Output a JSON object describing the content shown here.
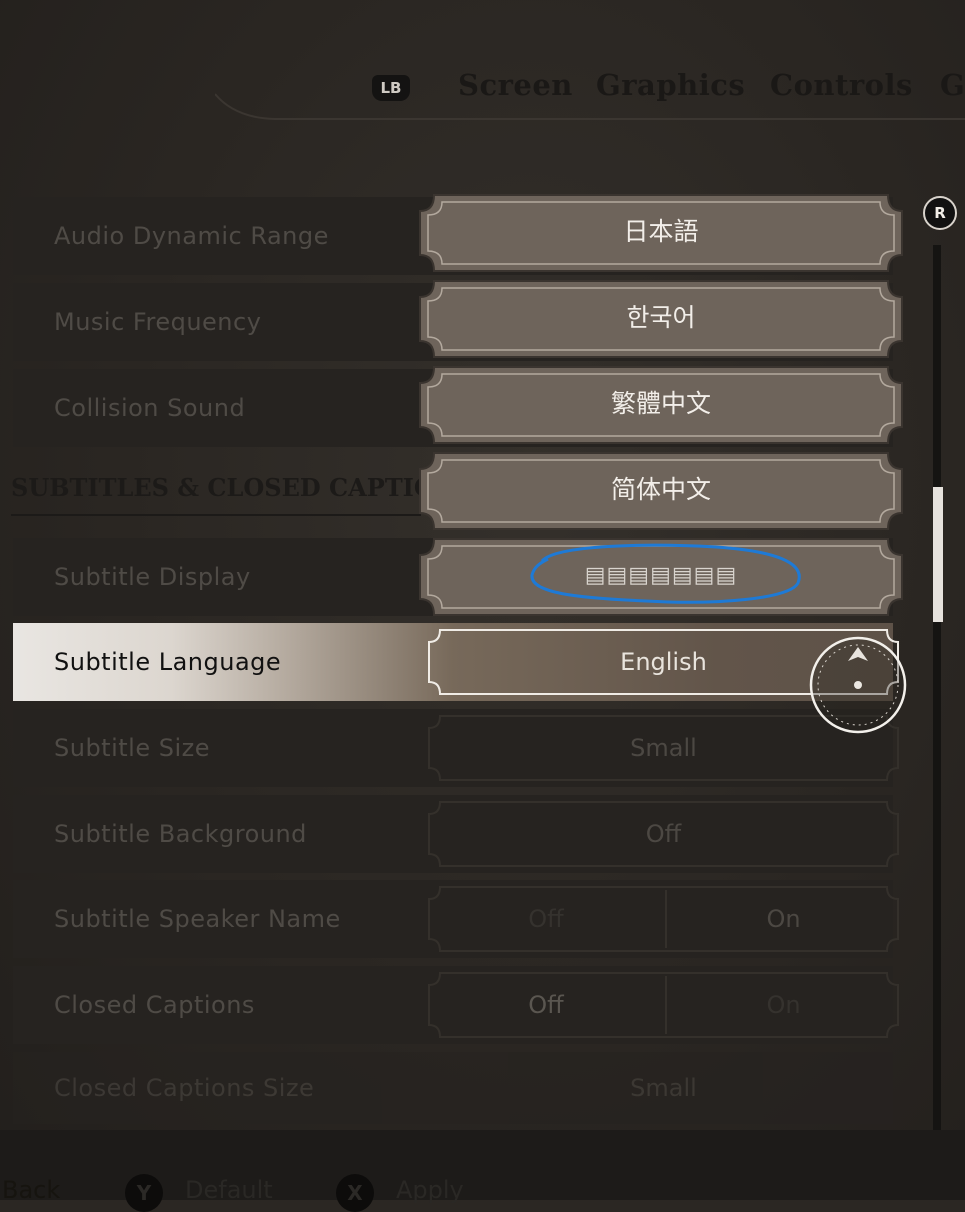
{
  "tabs": {
    "lb_label": "LB",
    "items": [
      {
        "label": "Screen"
      },
      {
        "label": "Graphics"
      },
      {
        "label": "Controls"
      },
      {
        "label": "G"
      }
    ]
  },
  "rows": {
    "audio_dynamic_range": {
      "label": "Audio Dynamic Range"
    },
    "music_frequency": {
      "label": "Music Frequency"
    },
    "collision_sound": {
      "label": "Collision Sound"
    },
    "subtitle_display": {
      "label": "Subtitle Display"
    },
    "subtitle_language": {
      "label": "Subtitle Language",
      "value": "English"
    },
    "subtitle_size": {
      "label": "Subtitle Size",
      "value": "Small"
    },
    "subtitle_background": {
      "label": "Subtitle Background",
      "value": "Off"
    },
    "subtitle_speaker_name": {
      "label": "Subtitle Speaker Name",
      "off": "Off",
      "on": "On"
    },
    "closed_captions": {
      "label": "Closed Captions",
      "off": "Off",
      "on": "On"
    },
    "closed_captions_size": {
      "label": "Closed Captions Size",
      "value": "Small"
    }
  },
  "section": {
    "title": "SUBTITLES & CLOSED CAPTION"
  },
  "dropdown": {
    "options": [
      {
        "label": "日本語"
      },
      {
        "label": "한국어"
      },
      {
        "label": "繁體中文"
      },
      {
        "label": "简体中文"
      },
      {
        "label": "▤▤▤▤▤▤▤"
      }
    ],
    "highlight_color": "#1e7ad6"
  },
  "scrollbar": {
    "badge": "R"
  },
  "footer": {
    "back": "Back",
    "default_key": "Y",
    "default": "Default",
    "apply_key": "X",
    "apply": "Apply"
  }
}
